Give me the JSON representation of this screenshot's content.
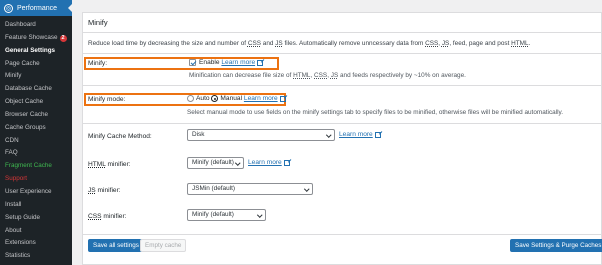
{
  "sidebar": {
    "header": "Performance",
    "items": [
      {
        "label": "Dashboard"
      },
      {
        "label": "Feature Showcase",
        "badge": "2"
      },
      {
        "label": "General Settings",
        "current": true
      },
      {
        "label": "Page Cache"
      },
      {
        "label": "Minify"
      },
      {
        "label": "Database Cache"
      },
      {
        "label": "Object Cache"
      },
      {
        "label": "Browser Cache"
      },
      {
        "label": "Cache Groups"
      },
      {
        "label": "CDN"
      },
      {
        "label": "FAQ"
      },
      {
        "label": "Fragment Cache",
        "color": "green"
      },
      {
        "label": "Support",
        "color": "red"
      },
      {
        "label": "User Experience"
      },
      {
        "label": "Install"
      },
      {
        "label": "Setup Guide"
      },
      {
        "label": "About"
      },
      {
        "label": "Extensions"
      },
      {
        "label": "Statistics"
      }
    ]
  },
  "section": {
    "title": "Minify",
    "description_pre": "Reduce load time by decreasing the size and number of ",
    "css": "CSS",
    "and": " and ",
    "js": "JS",
    "description_post": " files. Automatically remove unncessary data from ",
    "css2": "CSS",
    "comma1": ", ",
    "js2": "JS",
    "comma2": ", feed, page and post ",
    "html": "HTML",
    "period": "."
  },
  "minify": {
    "label": "Minify:",
    "checkbox_label": "Enable",
    "learn_more": "Learn more",
    "note_pre": "Minification can decrease file size of ",
    "note_html": "HTML",
    "note_sep1": ", ",
    "note_css": "CSS",
    "note_sep2": ", ",
    "note_js": "JS",
    "note_post": " and feeds respectively by ~10% on average."
  },
  "minify_mode": {
    "label": "Minify mode:",
    "auto_label": "Auto",
    "manual_label": "Manual",
    "learn_more": "Learn more",
    "note": "Select manual mode to use fields on the minify settings tab to specify files to be minified, otherwise files will be minified automatically."
  },
  "cache_method": {
    "label": "Minify Cache Method:",
    "value": "Disk",
    "learn_more": "Learn more"
  },
  "html_minifier": {
    "label_abbr": "HTML",
    "label_rest": " minifier:",
    "value": "Minify (default)",
    "learn_more": "Learn more"
  },
  "js_minifier": {
    "label_abbr": "JS",
    "label_rest": " minifier:",
    "value": "JSMin (default)"
  },
  "css_minifier": {
    "label_abbr": "CSS",
    "label_rest": " minifier:",
    "value": "Minify (default)"
  },
  "buttons": {
    "save_all": "Save all settings",
    "empty_cache": "Empty cache",
    "save_purge": "Save Settings & Purge Caches"
  },
  "colors": {
    "accent": "#2271b1",
    "highlight": "#ec7211",
    "sidebar_bg": "#1d2327"
  }
}
